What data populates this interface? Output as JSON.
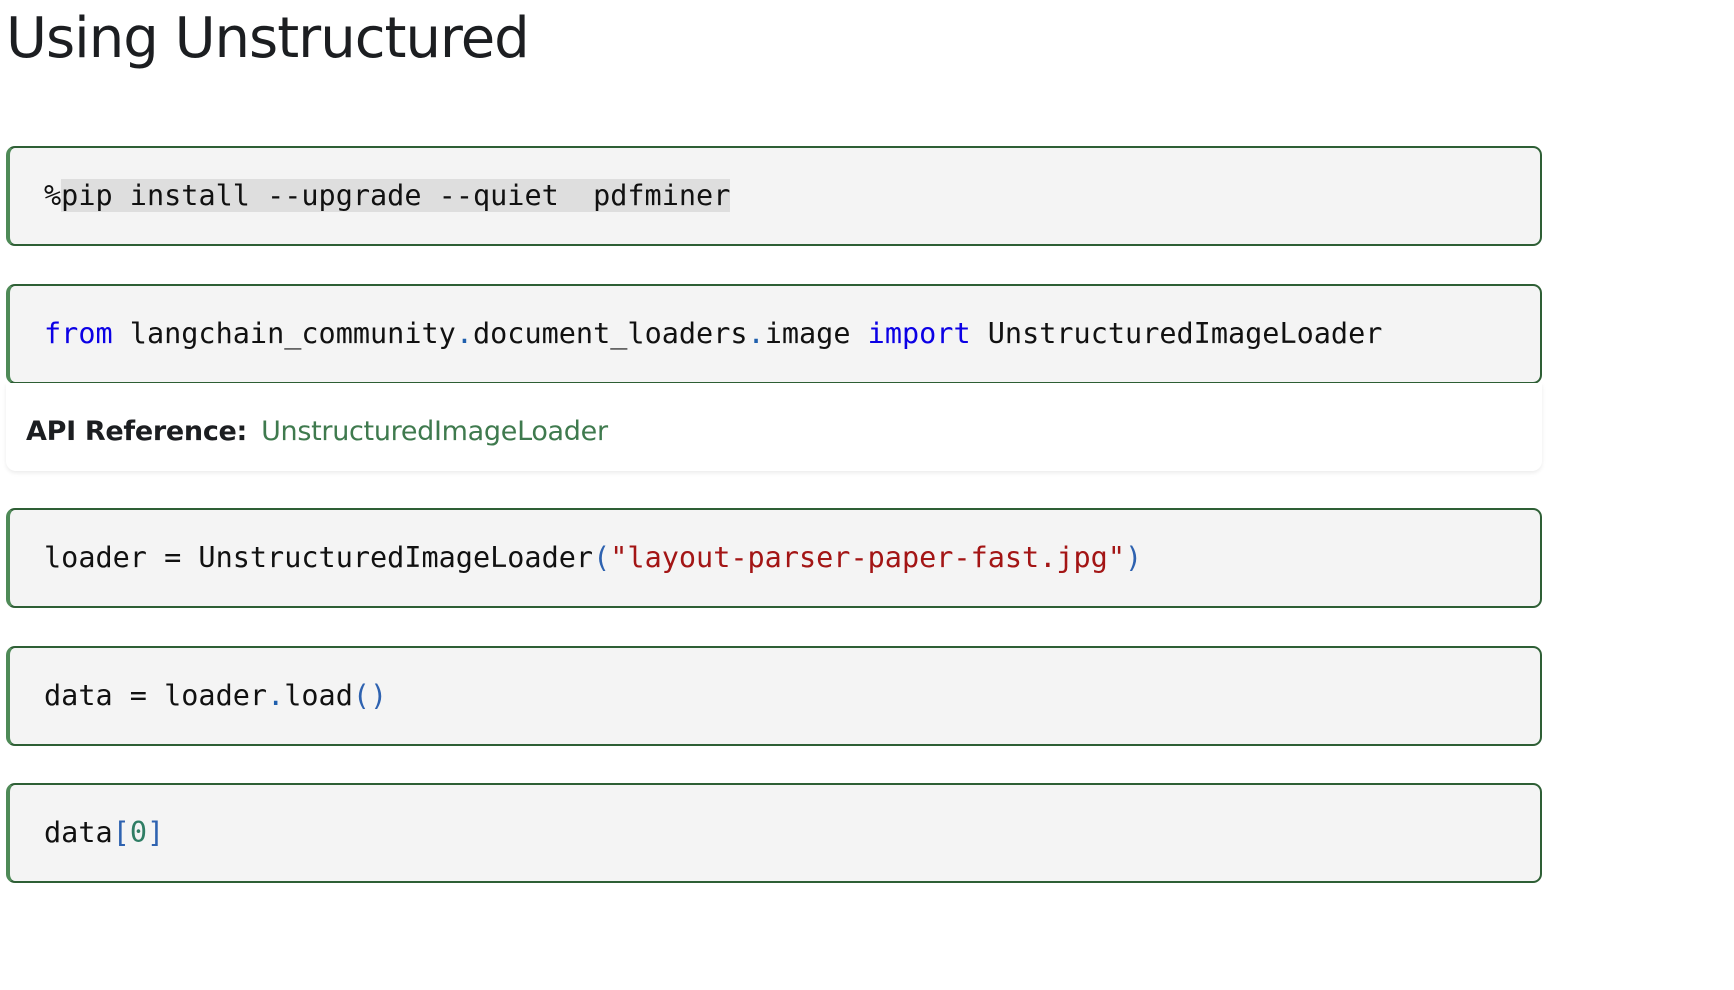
{
  "page": {
    "title": "Using Unstructured"
  },
  "cells": {
    "pip": {
      "prefix": "%",
      "highlighted": "pip install --upgrade --quiet  pdfminer"
    },
    "import": {
      "kw_from": "from",
      "module_1": " langchain_community",
      "dot_1": ".",
      "module_2": "document_loaders",
      "dot_2": ".",
      "module_3": "image ",
      "kw_import": "import",
      "name": " UnstructuredImageLoader"
    },
    "loader": {
      "lhs": "loader = UnstructuredImageLoader",
      "open_paren": "(",
      "string": "\"layout-parser-paper-fast.jpg\"",
      "close_paren": ")"
    },
    "load": {
      "lhs": "data = loader",
      "dot": ".",
      "method": "load",
      "parens": "()"
    },
    "index": {
      "name": "data",
      "open_bracket": "[",
      "index": "0",
      "close_bracket": "]"
    }
  },
  "api_reference": {
    "label": "API Reference:",
    "link_text": "UnstructuredImageLoader"
  },
  "colors": {
    "keyword": "#0b00e5",
    "string": "#a31515",
    "link": "#3f7a4e",
    "cell_border": "#2e5f35",
    "cell_background": "#f4f4f4"
  }
}
